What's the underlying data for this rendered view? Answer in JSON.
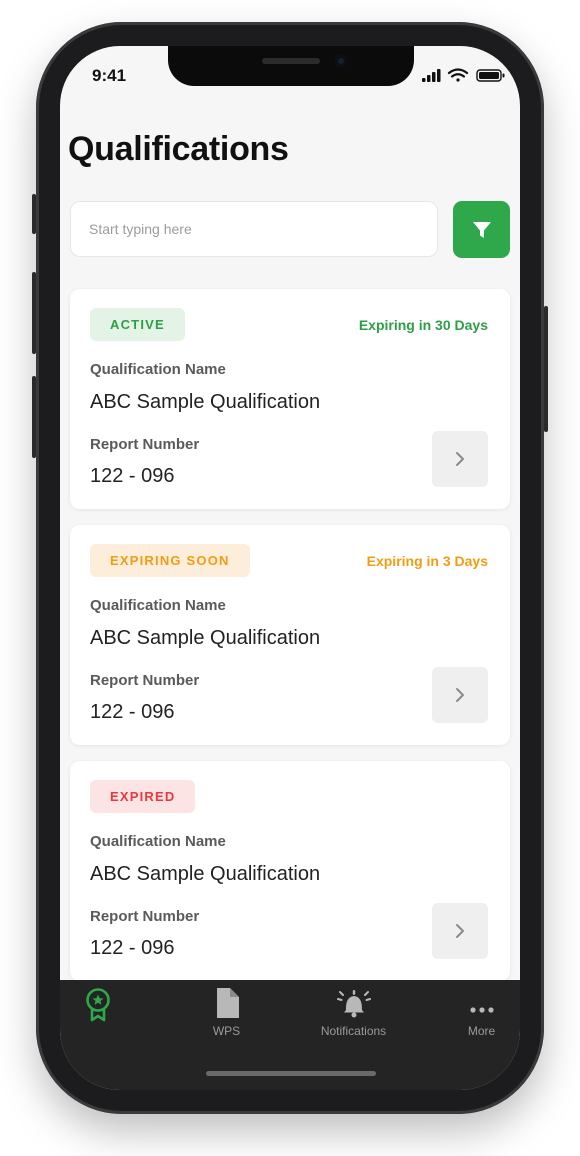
{
  "status_bar": {
    "time": "9:41"
  },
  "page": {
    "title": "Qualifications"
  },
  "search": {
    "placeholder": "Start typing here"
  },
  "colors": {
    "accent": "#2ea84b",
    "active_text": "#2e9e47",
    "active_bg": "#e3f3e6",
    "expiring_text": "#f39c12",
    "expiring_bg": "#fdeedb",
    "expired_text": "#e8383d",
    "expired_bg": "#fde4e4"
  },
  "cards": [
    {
      "status": "ACTIVE",
      "expiry": "Expiring in 30 Days",
      "name_label": "Qualification Name",
      "name": "ABC Sample Qualification",
      "report_label": "Report Number",
      "report": "122 - 096"
    },
    {
      "status": "EXPIRING SOON",
      "expiry": "Expiring in 3 Days",
      "name_label": "Qualification Name",
      "name": "ABC Sample Qualification",
      "report_label": "Report Number",
      "report": "122 - 096"
    },
    {
      "status": "EXPIRED",
      "expiry": "",
      "name_label": "Qualification Name",
      "name": "ABC Sample Qualification",
      "report_label": "Report Number",
      "report": "122 - 096"
    }
  ],
  "tabbar": {
    "items": [
      {
        "icon": "award-icon",
        "label": "",
        "active": true
      },
      {
        "icon": "document-icon",
        "label": "WPS"
      },
      {
        "icon": "bell-icon",
        "label": "Notifications"
      },
      {
        "icon": "more-icon",
        "label": "More"
      }
    ]
  }
}
